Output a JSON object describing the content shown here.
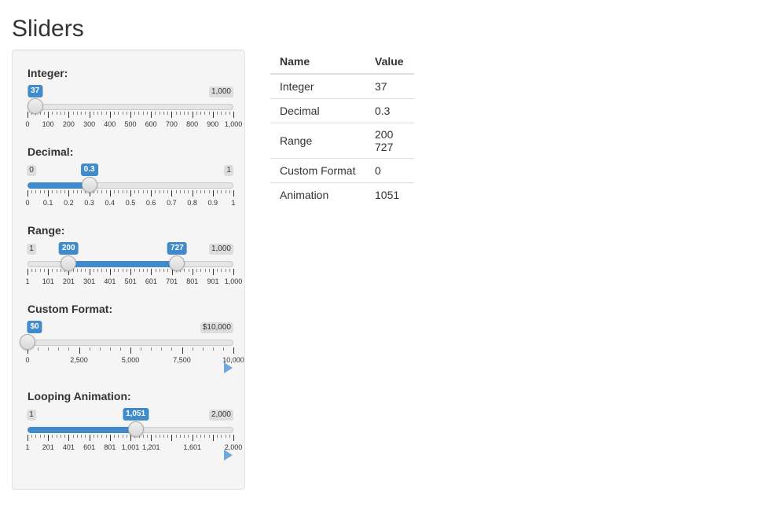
{
  "page": {
    "title": "Sliders"
  },
  "sliders": [
    {
      "id": "integer",
      "label": "Integer:",
      "min": 0,
      "max": 1000,
      "min_label": "0",
      "max_label": "1,000",
      "value": 37,
      "value_label": "37",
      "show_min_label": false,
      "fill_from": 0,
      "fill_to": 37,
      "handles": [
        37
      ],
      "ticks": [
        {
          "value": 0,
          "label": "0"
        },
        {
          "value": 100,
          "label": "100"
        },
        {
          "value": 200,
          "label": "200"
        },
        {
          "value": 300,
          "label": "300"
        },
        {
          "value": 400,
          "label": "400"
        },
        {
          "value": 500,
          "label": "500"
        },
        {
          "value": 600,
          "label": "600"
        },
        {
          "value": 700,
          "label": "700"
        },
        {
          "value": 800,
          "label": "800"
        },
        {
          "value": 900,
          "label": "900"
        },
        {
          "value": 1000,
          "label": "1,000"
        }
      ],
      "minor_per_major": 4,
      "play": false
    },
    {
      "id": "decimal",
      "label": "Decimal:",
      "min": 0,
      "max": 1,
      "min_label": "0",
      "max_label": "1",
      "value": 0.3,
      "value_label": "0.3",
      "show_min_label": true,
      "fill_from": 0,
      "fill_to": 0.3,
      "handles": [
        0.3
      ],
      "ticks": [
        {
          "value": 0,
          "label": "0"
        },
        {
          "value": 0.1,
          "label": "0.1"
        },
        {
          "value": 0.2,
          "label": "0.2"
        },
        {
          "value": 0.3,
          "label": "0.3"
        },
        {
          "value": 0.4,
          "label": "0.4"
        },
        {
          "value": 0.5,
          "label": "0.5"
        },
        {
          "value": 0.6,
          "label": "0.6"
        },
        {
          "value": 0.7,
          "label": "0.7"
        },
        {
          "value": 0.8,
          "label": "0.8"
        },
        {
          "value": 0.9,
          "label": "0.9"
        },
        {
          "value": 1,
          "label": "1"
        }
      ],
      "minor_per_major": 4,
      "play": false
    },
    {
      "id": "range",
      "label": "Range:",
      "min": 1,
      "max": 1000,
      "min_label": "1",
      "max_label": "1,000",
      "values": [
        200,
        727
      ],
      "value_labels": [
        "200",
        "727"
      ],
      "show_min_label": true,
      "fill_from": 200,
      "fill_to": 727,
      "handles": [
        200,
        727
      ],
      "ticks": [
        {
          "value": 1,
          "label": "1"
        },
        {
          "value": 101,
          "label": "101"
        },
        {
          "value": 201,
          "label": "201"
        },
        {
          "value": 301,
          "label": "301"
        },
        {
          "value": 401,
          "label": "401"
        },
        {
          "value": 501,
          "label": "501"
        },
        {
          "value": 601,
          "label": "601"
        },
        {
          "value": 701,
          "label": "701"
        },
        {
          "value": 801,
          "label": "801"
        },
        {
          "value": 901,
          "label": "901"
        },
        {
          "value": 1000,
          "label": "1,000"
        }
      ],
      "minor_per_major": 4,
      "play": false
    },
    {
      "id": "custom-format",
      "label": "Custom Format:",
      "min": 0,
      "max": 10000,
      "min_label": "$0",
      "max_label": "$10,000",
      "value": 0,
      "value_label": "$0",
      "show_min_label": false,
      "fill_from": 0,
      "fill_to": 0,
      "handles": [
        0
      ],
      "ticks": [
        {
          "value": 0,
          "label": "0"
        },
        {
          "value": 2500,
          "label": "2,500"
        },
        {
          "value": 5000,
          "label": "5,000"
        },
        {
          "value": 7500,
          "label": "7,500"
        },
        {
          "value": 10000,
          "label": "10,000"
        }
      ],
      "minor_per_major": 4,
      "play": true
    },
    {
      "id": "animation",
      "label": "Looping Animation:",
      "min": 1,
      "max": 2000,
      "min_label": "1",
      "max_label": "2,000",
      "value": 1051,
      "value_label": "1,051",
      "show_min_label": true,
      "fill_from": 1,
      "fill_to": 1051,
      "handles": [
        1051
      ],
      "ticks": [
        {
          "value": 1,
          "label": "1"
        },
        {
          "value": 201,
          "label": "201"
        },
        {
          "value": 401,
          "label": "401"
        },
        {
          "value": 601,
          "label": "601"
        },
        {
          "value": 801,
          "label": "801"
        },
        {
          "value": 1001,
          "label": "1,001"
        },
        {
          "value": 1201,
          "label": "1,201"
        },
        {
          "value": 1401,
          "label": ""
        },
        {
          "value": 1601,
          "label": "1,601"
        },
        {
          "value": 1801,
          "label": ""
        },
        {
          "value": 2000,
          "label": "2,000"
        }
      ],
      "minor_per_major": 4,
      "play": true
    }
  ],
  "table": {
    "headers": {
      "name": "Name",
      "value": "Value"
    },
    "rows": [
      {
        "name": "Integer",
        "value": "37"
      },
      {
        "name": "Decimal",
        "value": "0.3"
      },
      {
        "name": "Range",
        "value": "200 727"
      },
      {
        "name": "Custom Format",
        "value": "0"
      },
      {
        "name": "Animation",
        "value": "1051"
      }
    ]
  },
  "colors": {
    "accent": "#428bca",
    "panel_bg": "#f5f5f5",
    "play_icon": "#6fa8dc"
  },
  "icons": {
    "play": "play-icon"
  }
}
